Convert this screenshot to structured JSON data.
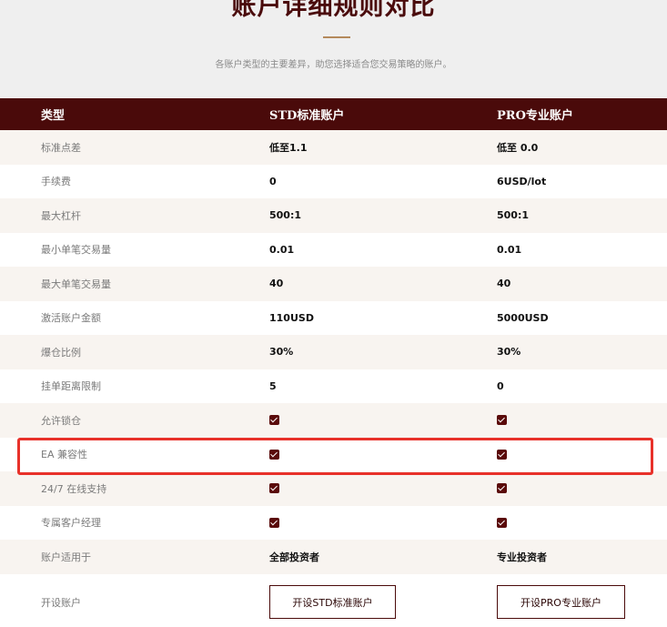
{
  "header": {
    "title": "账户详细规则对比",
    "subtitle": "各账户类型的主要差异，助您选择适合您交易策略的账户。"
  },
  "table": {
    "columns": [
      "类型",
      "STD标准账户",
      "PRO专业账户"
    ],
    "rows": [
      {
        "label": "标准点差",
        "std": "低至1.1",
        "pro": "低至 0.0"
      },
      {
        "label": "手续费",
        "std": "0",
        "pro": "6USD/lot"
      },
      {
        "label": "最大杠杆",
        "std": "500:1",
        "pro": "500:1"
      },
      {
        "label": "最小单笔交易量",
        "std": "0.01",
        "pro": "0.01"
      },
      {
        "label": "最大单笔交易量",
        "std": "40",
        "pro": "40"
      },
      {
        "label": "激活账户金额",
        "std": "110USD",
        "pro": "5000USD"
      },
      {
        "label": "爆仓比例",
        "std": "30%",
        "pro": "30%"
      },
      {
        "label": "挂单距离限制",
        "std": "5",
        "pro": "0"
      },
      {
        "label": "允许锁仓",
        "std": true,
        "pro": true
      },
      {
        "label": "EA 兼容性",
        "std": true,
        "pro": true
      },
      {
        "label": "24/7 在线支持",
        "std": true,
        "pro": true
      },
      {
        "label": "专属客户经理",
        "std": true,
        "pro": true
      },
      {
        "label": "账户适用于",
        "std": "全部投资者",
        "pro": "专业投资者"
      }
    ],
    "open": {
      "label": "开设账户",
      "std_button": "开设STD标准账户",
      "pro_button": "开设PRO专业账户"
    }
  },
  "colors": {
    "header_bg": "#4a0a0a",
    "title": "#4a0b0c",
    "highlight": "#e8312a"
  }
}
